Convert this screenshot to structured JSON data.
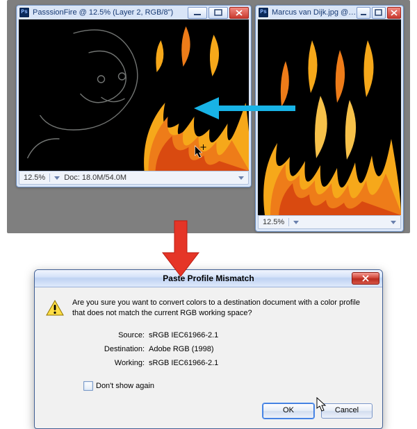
{
  "win1": {
    "title": "PasssionFire @ 12.5% (Layer 2, RGB/8\")",
    "zoom": "12.5%",
    "docinfo": "Doc: 18.0M/54.0M"
  },
  "win2": {
    "title": "Marcus van Dijk.jpg @ ...",
    "zoom": "12.5%"
  },
  "dialog": {
    "title": "Paste Profile Mismatch",
    "message": "Are you sure you want to convert colors to a destination document with a color profile that does not match the current RGB working space?",
    "source_label": "Source:",
    "source_value": "sRGB IEC61966-2.1",
    "dest_label": "Destination:",
    "dest_value": "Adobe RGB (1998)",
    "work_label": "Working:",
    "work_value": "sRGB IEC61966-2.1",
    "dont_show": "Don't show again",
    "ok": "OK",
    "cancel": "Cancel"
  }
}
